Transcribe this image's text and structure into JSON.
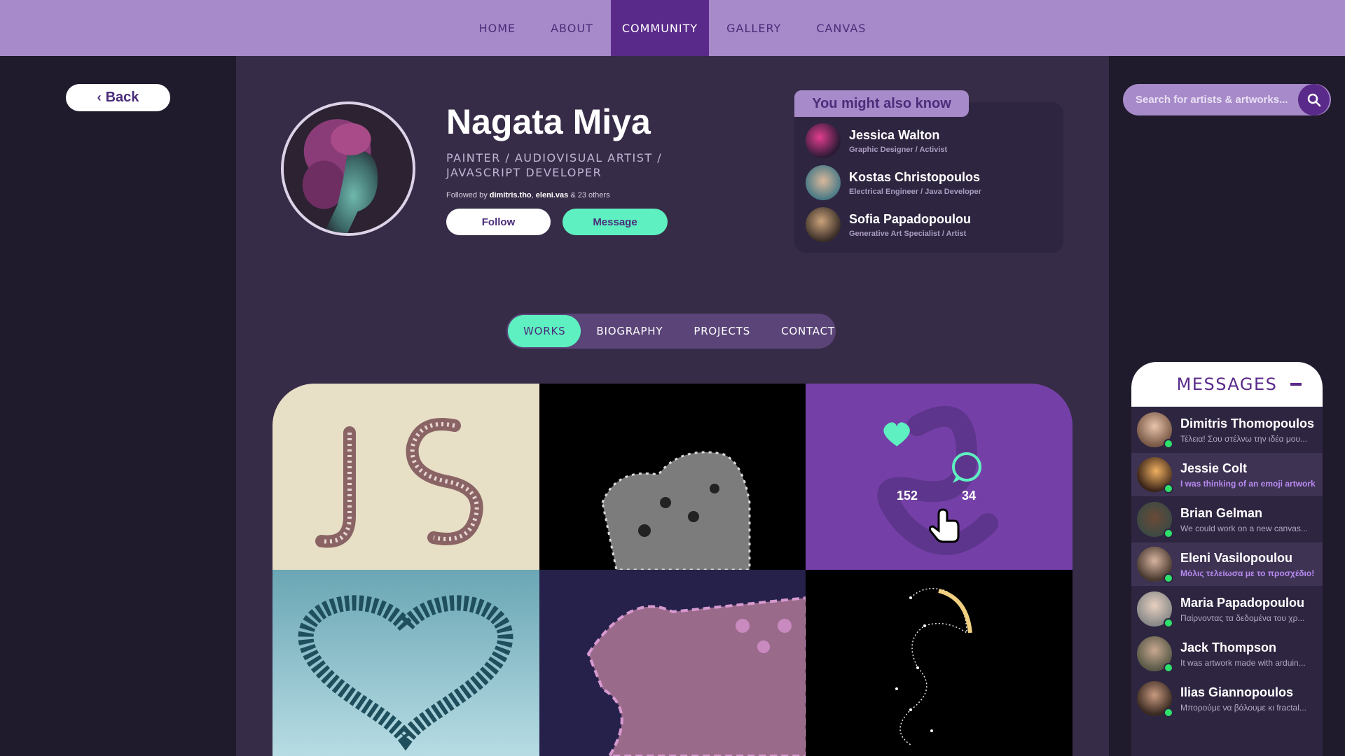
{
  "nav": {
    "items": [
      {
        "label": "HOME"
      },
      {
        "label": "ABOUT"
      },
      {
        "label": "COMMUNITY"
      },
      {
        "label": "GALLERY"
      },
      {
        "label": "CANVAS"
      }
    ],
    "active": "COMMUNITY"
  },
  "back_label": "Back",
  "profile": {
    "name": "Nagata Miya",
    "role": "PAINTER / AUDIOVISUAL ARTIST / JAVASCRIPT DEVELOPER",
    "followed_prefix": "Followed by",
    "followed_user1": "dimitris.tho",
    "followed_user2": "eleni.vas",
    "followed_suffix": "& 23 others",
    "follow_label": "Follow",
    "message_label": "Message"
  },
  "might_know": {
    "title": "You might also know",
    "people": [
      {
        "name": "Jessica Walton",
        "role": "Graphic Designer / Activist"
      },
      {
        "name": "Kostas Christopoulos",
        "role": "Electrical Engineer / Java Developer"
      },
      {
        "name": "Sofia Papadopoulou",
        "role": "Generative Art Specialist / Artist"
      }
    ]
  },
  "tabs": [
    {
      "label": "WORKS"
    },
    {
      "label": "BIOGRAPHY"
    },
    {
      "label": "PROJECTS"
    },
    {
      "label": "CONTACT"
    }
  ],
  "active_tab": "WORKS",
  "gallery": {
    "hover_stats": {
      "likes": "152",
      "comments": "34"
    }
  },
  "search": {
    "placeholder": "Search for artists & artworks..."
  },
  "messages": {
    "title": "MESSAGES",
    "threads": [
      {
        "name": "Dimitris Thomopoulos",
        "preview": "Τέλεια! Σου στέλνω την ιδέα μου...",
        "unread": false
      },
      {
        "name": "Jessie Colt",
        "preview": "I was thinking of an emoji artwork",
        "unread": true
      },
      {
        "name": "Brian Gelman",
        "preview": "We could work on a new canvas...",
        "unread": false
      },
      {
        "name": "Eleni Vasilopoulou",
        "preview": "Μόλις τελείωσα με το προσχέδιο!",
        "unread": true
      },
      {
        "name": "Maria Papadopoulou",
        "preview": "Παίρνοντας τα δεδομένα του χρ...",
        "unread": false
      },
      {
        "name": "Jack Thompson",
        "preview": "It was artwork made with arduin...",
        "unread": false
      },
      {
        "name": "Ilias Giannopoulos",
        "preview": "Μπορούμε να βάλουμε κι fractal...",
        "unread": false
      }
    ]
  },
  "colors": {
    "nav_bg": "#a78ac9",
    "nav_active": "#5a2a8a",
    "accent_mint": "#5ef0c0",
    "main_bg": "#372c47",
    "page_bg": "#1f1a2c",
    "online_dot": "#2de16a"
  }
}
